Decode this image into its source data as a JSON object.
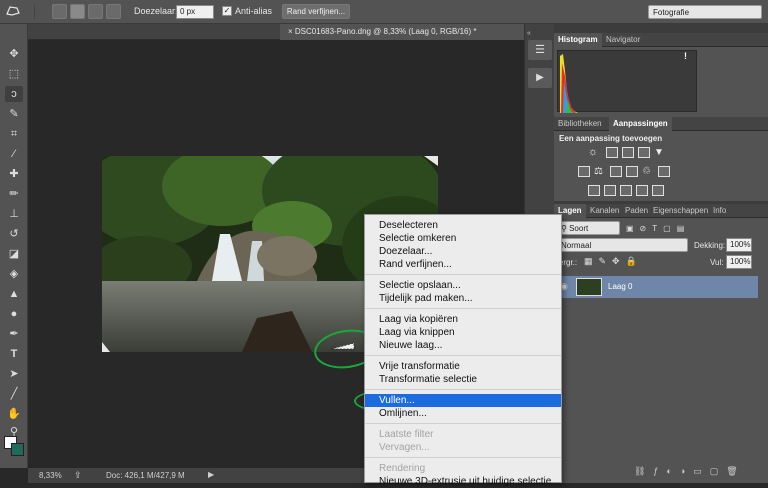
{
  "options_bar": {
    "feather_label": "Doezelaar:",
    "feather_value": "0 px",
    "antialias_label": "Anti-alias",
    "refine_edge_button": "Rand verfijnen...",
    "workspace": "Fotografie"
  },
  "document": {
    "tab_title": "DSC01683-Pano.dng @ 8,33% (Laag 0, RGB/16) *"
  },
  "status_bar": {
    "zoom": "8,33%",
    "doc_size": "Doc: 426,1 M/427,9 M"
  },
  "histogram_panel": {
    "tabs": [
      "Histogram",
      "Navigator"
    ],
    "warning_icon": "!"
  },
  "adjustments_panel": {
    "tabs": [
      "Bibliotheken",
      "Aanpassingen"
    ],
    "heading": "Een aanpassing toevoegen"
  },
  "layers_panel": {
    "tabs": [
      "Lagen",
      "Kanalen",
      "Paden",
      "Eigenschappen",
      "Info"
    ],
    "filter_kind": "Soort",
    "blend_mode": "Normaal",
    "opacity_label": "Dekking:",
    "opacity_value": "100%",
    "lock_label": "Vergr.:",
    "fill_label": "Vul:",
    "fill_value": "100%",
    "layers": [
      {
        "name": "Laag 0"
      }
    ]
  },
  "context_menu": {
    "items": [
      "Deselecteren",
      "Selectie omkeren",
      "Doezelaar...",
      "Rand verfijnen...",
      "Selectie opslaan...",
      "Tijdelijk pad maken...",
      "Laag via kopiëren",
      "Laag via knippen",
      "Nieuwe laag...",
      "Vrije transformatie",
      "Transformatie selectie",
      "Vullen...",
      "Omlijnen...",
      "Laatste filter",
      "Vervagen...",
      "Rendering",
      "Nieuwe 3D-extrusie uit huidige selectie"
    ],
    "highlighted": "Vullen...",
    "disabled": [
      "Laatste filter",
      "Vervagen...",
      "Rendering"
    ]
  },
  "colors": {
    "highlight": "#1c6ce0",
    "annotation_ring": "#1aa83a",
    "foreground_swatch": "#ffffff",
    "background_swatch": "#1e6b5a"
  }
}
